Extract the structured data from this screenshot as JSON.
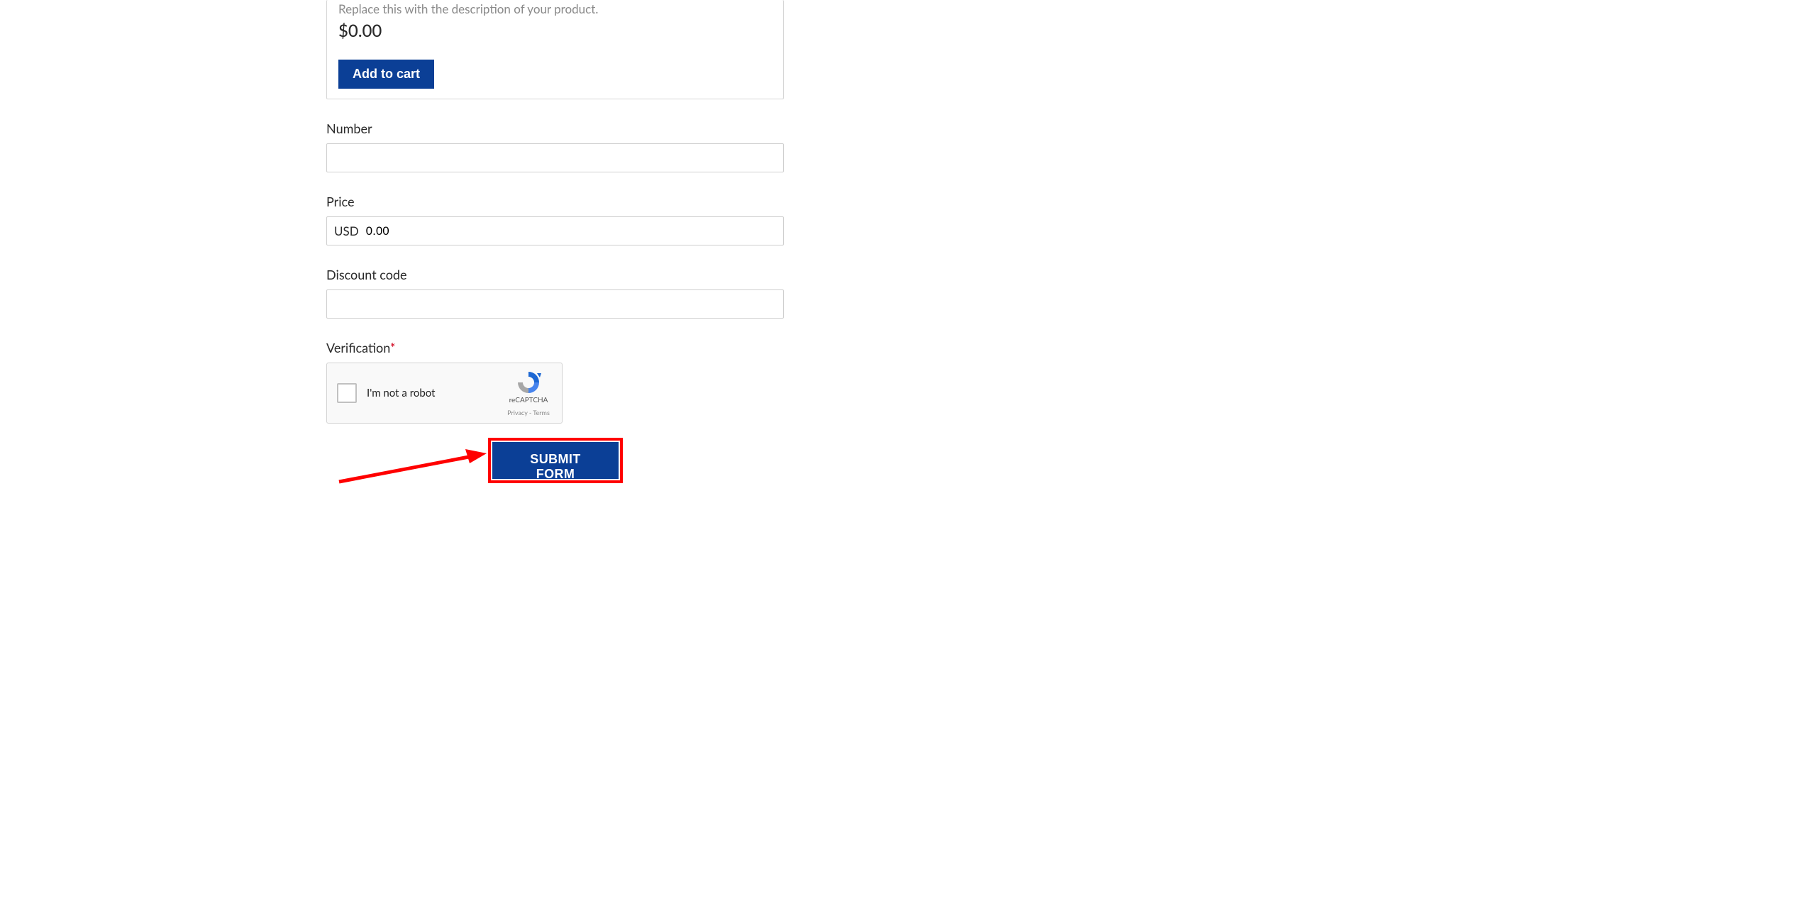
{
  "product": {
    "description": "Replace this with the description of your product.",
    "price": "$0.00",
    "add_label": "Add to cart"
  },
  "fields": {
    "number_label": "Number",
    "price_label": "Price",
    "price_currency": "USD",
    "price_value": "0.00",
    "discount_label": "Discount code",
    "verification_label": "Verification"
  },
  "recaptcha": {
    "text": "I'm not a robot",
    "brand": "reCAPTCHA",
    "links": "Privacy  -  Terms"
  },
  "submit": {
    "label": "SUBMIT FORM"
  }
}
